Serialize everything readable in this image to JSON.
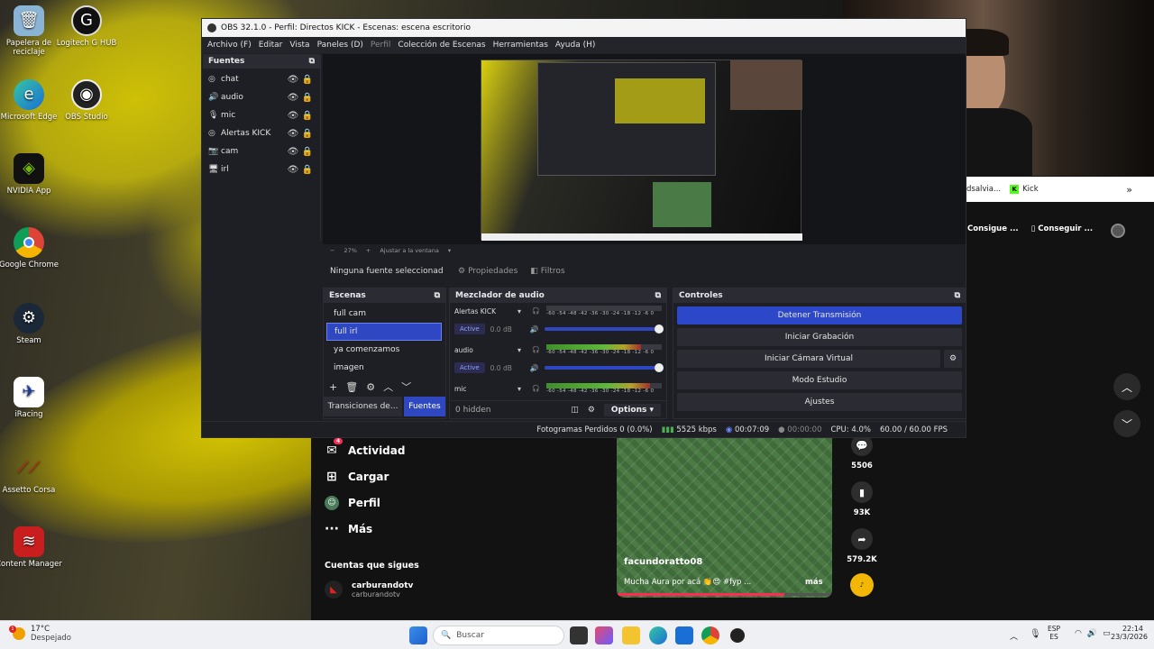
{
  "desktop_icons": [
    {
      "label": "Papelera de reciclaje",
      "icon": "recycle-bin-icon"
    },
    {
      "label": "Logitech G HUB",
      "icon": "logitech-icon"
    },
    {
      "label": "Microsoft Edge",
      "icon": "edge-icon"
    },
    {
      "label": "OBS Studio",
      "icon": "obs-icon"
    },
    {
      "label": "NVIDIA App",
      "icon": "nvidia-icon"
    },
    {
      "label": "Google Chrome",
      "icon": "chrome-icon"
    },
    {
      "label": "Steam",
      "icon": "steam-icon"
    },
    {
      "label": "iRacing",
      "icon": "iracing-icon"
    },
    {
      "label": "Assetto Corsa",
      "icon": "assetto-icon"
    },
    {
      "label": "Content Manager",
      "icon": "content-manager-icon"
    }
  ],
  "obs": {
    "title": "OBS 32.1.0 - Perfil: Directos KICK - Escenas: escena escritorio",
    "menu": [
      "Archivo (F)",
      "Editar",
      "Vista",
      "Paneles (D)",
      "Perfil",
      "Colección de Escenas",
      "Herramientas",
      "Ayuda (H)"
    ],
    "sources_title": "Fuentes",
    "sources": [
      {
        "label": "chat",
        "icon": "browser-icon"
      },
      {
        "label": "audio",
        "icon": "speaker-icon"
      },
      {
        "label": "mic",
        "icon": "mic-icon"
      },
      {
        "label": "Alertas KICK",
        "icon": "browser-icon"
      },
      {
        "label": "cam",
        "icon": "camera-icon"
      },
      {
        "label": "irl",
        "icon": "display-icon"
      }
    ],
    "zoom": {
      "level": "27%",
      "mode": "Ajustar a la ventana"
    },
    "no_source": "Ninguna fuente seleccionad",
    "properties": "Propiedades",
    "filters": "Filtros",
    "scenes_title": "Escenas",
    "scenes": [
      {
        "label": "full cam",
        "selected": false
      },
      {
        "label": "full irl",
        "selected": true
      },
      {
        "label": "ya comenzamos",
        "selected": false
      },
      {
        "label": "imagen",
        "selected": false
      }
    ],
    "tab_transitions": "Transiciones de...",
    "tab_sources": "Fuentes",
    "mixer_title": "Mezclador de audio",
    "mixer_scale": "-60 -54 -48 -42 -36 -30 -24 -18 -12 -6 0",
    "channels": [
      {
        "name": "Alertas KICK",
        "active": "Active",
        "db": "0.0 dB",
        "level": 0.0
      },
      {
        "name": "audio",
        "active": "Active",
        "db": "0.0 dB",
        "level": 0.82
      },
      {
        "name": "mic",
        "active": "",
        "db": "",
        "level": 0.9
      }
    ],
    "hidden_count": "0 hidden",
    "options": "Options",
    "controls_title": "Controles",
    "controls": [
      "Detener Transmisión",
      "Iniciar Grabación",
      "Iniciar Cámara Virtual",
      "Modo Estudio",
      "Ajustes"
    ],
    "status": {
      "dropped": "Fotogramas Perdidos 0 (0.0%)",
      "bitrate": "5525 kbps",
      "stream_time": "00:07:09",
      "rec_time": "00:00:00",
      "cpu": "CPU: 4.0%",
      "fps": "60.00 / 60.00 FPS"
    }
  },
  "browser": {
    "tab_partial": "dsalvia...",
    "bookmark": "Kick",
    "button1": "Consigue ...",
    "button2": "Conseguir ..."
  },
  "tiktok": {
    "nav": [
      {
        "label": "Actividad",
        "icon": "activity-icon",
        "badge": "4"
      },
      {
        "label": "Cargar",
        "icon": "upload-icon"
      },
      {
        "label": "Perfil",
        "icon": "profile-icon"
      },
      {
        "label": "Más",
        "icon": "more-icon"
      }
    ],
    "following_title": "Cuentas que sigues",
    "account_name": "carburandotv",
    "account_handle": "carburandotv",
    "video_author": "facundoratto08",
    "video_caption": "Mucha Aura por acá 👏😍 #fyp ...",
    "video_more": "más",
    "stats": {
      "comments": "5506",
      "saves": "93K",
      "shares": "579.2K"
    }
  },
  "taskbar": {
    "weather_temp": "17°C",
    "weather_desc": "Despejado",
    "search_placeholder": "Buscar",
    "lang1": "ESP",
    "lang2": "ES",
    "time": "22:14",
    "date": "23/3/2026"
  }
}
